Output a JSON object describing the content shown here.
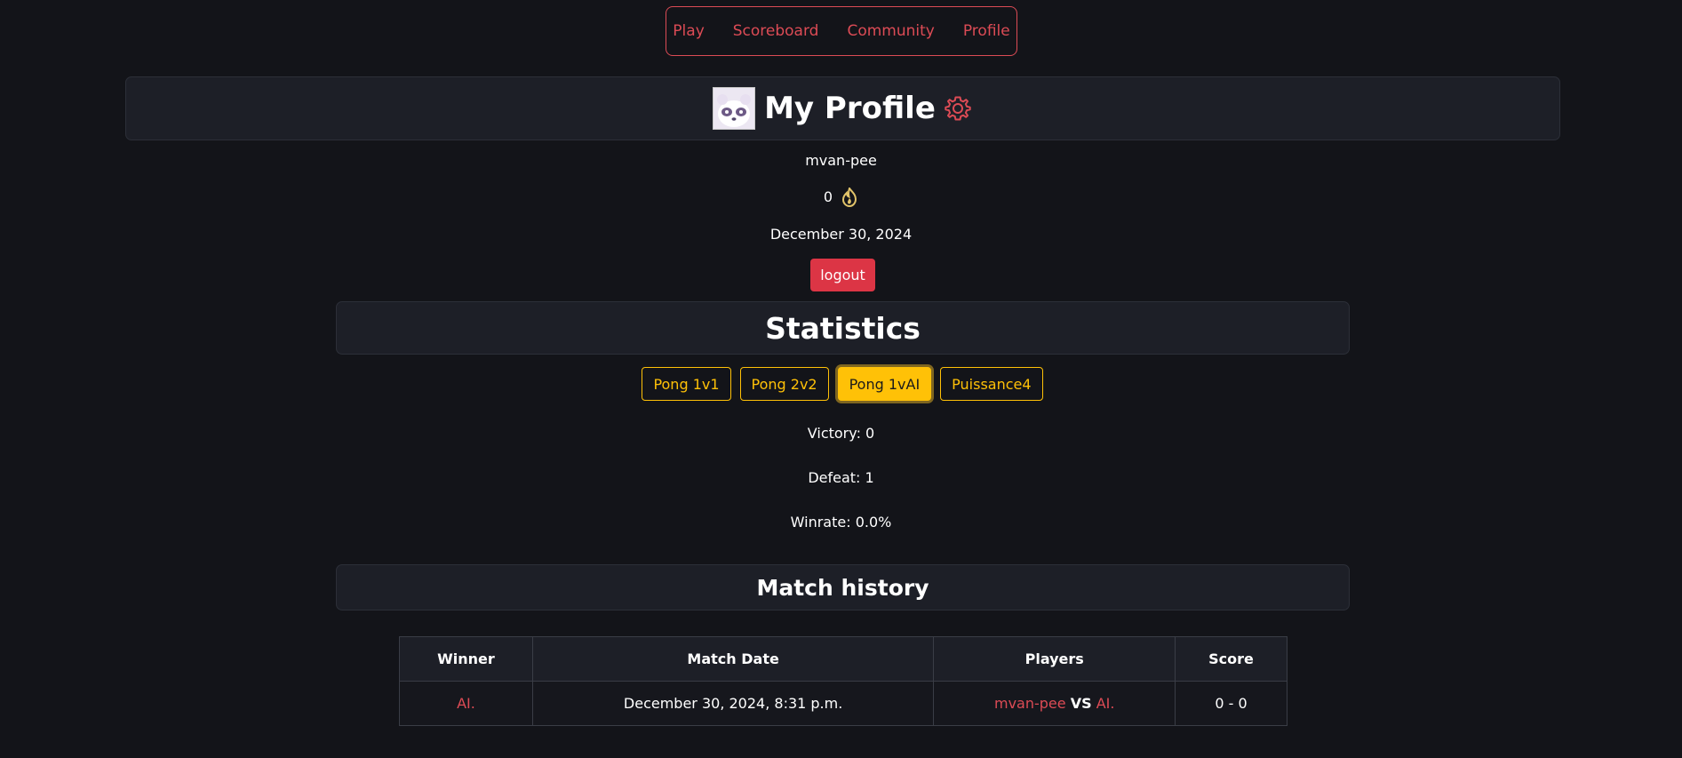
{
  "nav": {
    "items": [
      "Play",
      "Scoreboard",
      "Community",
      "Profile"
    ]
  },
  "profile": {
    "title": "My Profile",
    "username": "mvan-pee",
    "points": "0",
    "date": "December 30, 2024",
    "logout_label": "logout"
  },
  "statistics": {
    "title": "Statistics",
    "tabs": [
      "Pong 1v1",
      "Pong 2v2",
      "Pong 1vAI",
      "Puissance4"
    ],
    "active_tab": "Pong 1vAI",
    "victory": "Victory: 0",
    "defeat": "Defeat: 1",
    "winrate": "Winrate: 0.0%"
  },
  "history": {
    "title": "Match history",
    "columns": [
      "Winner",
      "Match Date",
      "Players",
      "Score"
    ],
    "rows": [
      {
        "winner": "AI.",
        "date": "December 30, 2024, 8:31 p.m.",
        "player1": "mvan-pee",
        "vs": "VS",
        "player2": "AI.",
        "score": "0 - 0"
      }
    ]
  },
  "colors": {
    "background": "#131419",
    "accent_red": "#dc4b55",
    "accent_yellow": "#ffc107",
    "logout": "#dc3545"
  }
}
